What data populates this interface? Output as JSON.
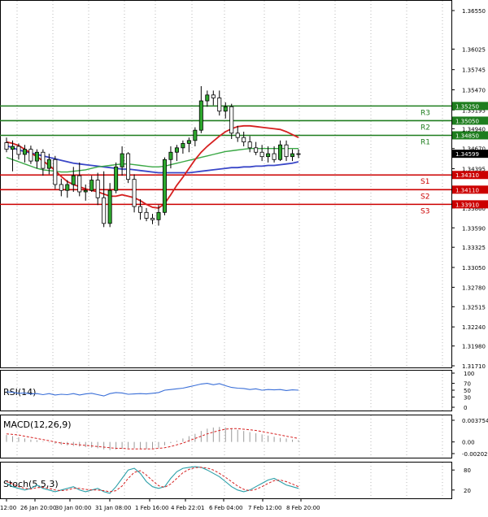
{
  "chart_data": {
    "type": "candlestick",
    "price_axis": {
      "ticks": [
        "1.36550",
        "1.36025",
        "1.35745",
        "1.35470",
        "1.35195",
        "1.34940",
        "1.34670",
        "1.34395",
        "1.34120",
        "1.33860",
        "1.33590",
        "1.33325",
        "1.33050",
        "1.32780",
        "1.32515",
        "1.32240",
        "1.31980",
        "1.31710"
      ],
      "min": 1.3171,
      "max": 1.3655
    },
    "x_axis_labels": [
      "12:00",
      "26 Jan 20:00",
      "30 Jan 00:00",
      "31 Jan 08:00",
      "1 Feb 16:00",
      "4 Feb 22:01",
      "6 Feb 04:00",
      "7 Feb 12:00",
      "8 Feb 20:00"
    ],
    "levels": [
      {
        "name": "R3",
        "value": 1.3525,
        "label": "1.35250",
        "color": "#1e7d1e"
      },
      {
        "name": "R2",
        "value": 1.3505,
        "label": "1.35050",
        "color": "#1e7d1e"
      },
      {
        "name": "R1",
        "value": 1.3485,
        "label": "1.34850",
        "color": "#1e7d1e"
      },
      {
        "name": "S1",
        "value": 1.3431,
        "label": "1.34310",
        "color": "#cc0000"
      },
      {
        "name": "S2",
        "value": 1.3411,
        "label": "1.34110",
        "color": "#cc0000"
      },
      {
        "name": "S3",
        "value": 1.3391,
        "label": "1.33910",
        "color": "#cc0000"
      }
    ],
    "current_price": {
      "value": 1.34599,
      "label": "1.34599"
    },
    "candles": [
      [
        1.3475,
        1.3482,
        1.3462,
        1.3466
      ],
      [
        1.3466,
        1.3478,
        1.3436,
        1.347
      ],
      [
        1.347,
        1.3474,
        1.3452,
        1.3459
      ],
      [
        1.3459,
        1.3472,
        1.3448,
        1.3466
      ],
      [
        1.3466,
        1.3471,
        1.3446,
        1.345
      ],
      [
        1.345,
        1.3466,
        1.344,
        1.3462
      ],
      [
        1.3462,
        1.3466,
        1.343,
        1.344
      ],
      [
        1.344,
        1.346,
        1.3432,
        1.3452
      ],
      [
        1.3452,
        1.3457,
        1.3412,
        1.3418
      ],
      [
        1.3418,
        1.3426,
        1.3402,
        1.341
      ],
      [
        1.341,
        1.3424,
        1.34,
        1.3418
      ],
      [
        1.3418,
        1.3442,
        1.3408,
        1.343
      ],
      [
        1.343,
        1.3448,
        1.3402,
        1.3408
      ],
      [
        1.3408,
        1.3418,
        1.3396,
        1.341
      ],
      [
        1.341,
        1.343,
        1.3408,
        1.3424
      ],
      [
        1.3424,
        1.3434,
        1.339,
        1.34
      ],
      [
        1.34,
        1.3436,
        1.336,
        1.3365
      ],
      [
        1.3365,
        1.342,
        1.336,
        1.341
      ],
      [
        1.341,
        1.3448,
        1.3406,
        1.3442
      ],
      [
        1.3442,
        1.347,
        1.343,
        1.346
      ],
      [
        1.346,
        1.3462,
        1.342,
        1.3425
      ],
      [
        1.3425,
        1.3432,
        1.338,
        1.3388
      ],
      [
        1.3388,
        1.3398,
        1.337,
        1.338
      ],
      [
        1.338,
        1.3386,
        1.3368,
        1.3372
      ],
      [
        1.3372,
        1.3378,
        1.3364,
        1.337
      ],
      [
        1.337,
        1.339,
        1.3362,
        1.338
      ],
      [
        1.338,
        1.3455,
        1.3376,
        1.3452
      ],
      [
        1.3452,
        1.347,
        1.344,
        1.3462
      ],
      [
        1.3462,
        1.3472,
        1.345,
        1.3468
      ],
      [
        1.3468,
        1.3478,
        1.346,
        1.3474
      ],
      [
        1.3474,
        1.3482,
        1.3462,
        1.3478
      ],
      [
        1.3478,
        1.3496,
        1.347,
        1.3492
      ],
      [
        1.3492,
        1.3552,
        1.3488,
        1.3532
      ],
      [
        1.3532,
        1.3546,
        1.3524,
        1.354
      ],
      [
        1.354,
        1.3546,
        1.3526,
        1.3536
      ],
      [
        1.3536,
        1.3546,
        1.3512,
        1.3518
      ],
      [
        1.3518,
        1.353,
        1.3508,
        1.3524
      ],
      [
        1.3524,
        1.3528,
        1.348,
        1.3488
      ],
      [
        1.3488,
        1.3498,
        1.3476,
        1.3482
      ],
      [
        1.3482,
        1.349,
        1.347,
        1.3476
      ],
      [
        1.3476,
        1.3484,
        1.3462,
        1.3468
      ],
      [
        1.3468,
        1.3476,
        1.3458,
        1.3462
      ],
      [
        1.3462,
        1.3472,
        1.345,
        1.3456
      ],
      [
        1.3456,
        1.347,
        1.3448,
        1.346
      ],
      [
        1.346,
        1.347,
        1.3448,
        1.3452
      ],
      [
        1.3452,
        1.3478,
        1.345,
        1.3472
      ],
      [
        1.3472,
        1.3478,
        1.345,
        1.3456
      ],
      [
        1.3456,
        1.3466,
        1.345,
        1.346
      ],
      [
        1.346,
        1.3466,
        1.3454,
        1.3459
      ]
    ],
    "ma_red": [
      1.3476,
      1.3474,
      1.3471,
      1.3466,
      1.3461,
      1.3456,
      1.345,
      1.3444,
      1.3437,
      1.3429,
      1.3422,
      1.3418,
      1.3415,
      1.3412,
      1.341,
      1.3408,
      1.3405,
      1.3402,
      1.3402,
      1.3404,
      1.3402,
      1.34,
      1.3396,
      1.3391,
      1.3387,
      1.3386,
      1.3392,
      1.3404,
      1.3417,
      1.3428,
      1.344,
      1.3452,
      1.3462,
      1.347,
      1.3477,
      1.3484,
      1.349,
      1.3494,
      1.3497,
      1.3498,
      1.3498,
      1.3497,
      1.3496,
      1.3495,
      1.3494,
      1.3493,
      1.349,
      1.3486,
      1.3482
    ],
    "ma_green": [
      1.3455,
      1.3452,
      1.3449,
      1.3446,
      1.3443,
      1.344,
      1.3438,
      1.3437,
      1.3436,
      1.3435,
      1.3435,
      1.3436,
      1.3437,
      1.3438,
      1.344,
      1.3442,
      1.3443,
      1.3444,
      1.3445,
      1.3446,
      1.3446,
      1.3445,
      1.3444,
      1.3443,
      1.3442,
      1.3442,
      1.3443,
      1.3445,
      1.3447,
      1.3449,
      1.3451,
      1.3453,
      1.3455,
      1.3457,
      1.3459,
      1.3461,
      1.3463,
      1.3464,
      1.3465,
      1.3466,
      1.3467,
      1.3467,
      1.3467,
      1.3467,
      1.3467,
      1.3467,
      1.3467,
      1.3467,
      1.3467
    ],
    "ma_blue": [
      1.3471,
      1.3468,
      1.3465,
      1.3463,
      1.3461,
      1.3459,
      1.3457,
      1.3455,
      1.3453,
      1.3451,
      1.3449,
      1.3447,
      1.3446,
      1.3445,
      1.3444,
      1.3443,
      1.3442,
      1.3441,
      1.344,
      1.3439,
      1.3439,
      1.3438,
      1.3437,
      1.3436,
      1.3435,
      1.3434,
      1.3434,
      1.3434,
      1.3434,
      1.3434,
      1.3434,
      1.3435,
      1.3436,
      1.3437,
      1.3438,
      1.3439,
      1.344,
      1.3441,
      1.3441,
      1.3442,
      1.3442,
      1.3443,
      1.3443,
      1.3444,
      1.3444,
      1.3445,
      1.3446,
      1.3447,
      1.3449
    ],
    "rsi": {
      "label": "RSI(14)",
      "ticks": [
        "100",
        "70",
        "50",
        "30",
        "0"
      ],
      "values": [
        45,
        44,
        41,
        42,
        39,
        40,
        37,
        40,
        36,
        38,
        37,
        40,
        36,
        39,
        41,
        37,
        33,
        40,
        43,
        42,
        38,
        39,
        40,
        39,
        41,
        43,
        50,
        52,
        54,
        56,
        60,
        64,
        68,
        70,
        66,
        69,
        63,
        58,
        56,
        55,
        52,
        54,
        50,
        52,
        51,
        52,
        49,
        51,
        50
      ]
    },
    "macd": {
      "label": "MACD(12,26,9)",
      "ticks": [
        "0.003754",
        "0.00",
        "-0.002021"
      ],
      "histogram": [
        0.0012,
        0.001,
        0.0008,
        0.0006,
        0.0004,
        0.0003,
        0.0001,
        -0.0001,
        -0.0003,
        -0.0005,
        -0.0006,
        -0.0007,
        -0.0008,
        -0.0009,
        -0.001,
        -0.0011,
        -0.0013,
        -0.0014,
        -0.0013,
        -0.0012,
        -0.0011,
        -0.0011,
        -0.0012,
        -0.0012,
        -0.0011,
        -0.001,
        -0.0006,
        -0.0002,
        0.0002,
        0.0006,
        0.001,
        0.0014,
        0.0019,
        0.0023,
        0.0025,
        0.0026,
        0.0025,
        0.0023,
        0.0021,
        0.0019,
        0.0017,
        0.0015,
        0.0013,
        0.0011,
        0.0009,
        0.0007,
        0.0006,
        0.0004,
        0.0003
      ],
      "signal": [
        0.0014,
        0.0013,
        0.0012,
        0.001,
        0.0008,
        0.0006,
        0.0004,
        0.0002,
        0.0,
        -0.0002,
        -0.0003,
        -0.0004,
        -0.0005,
        -0.0006,
        -0.0007,
        -0.0008,
        -0.0009,
        -0.001,
        -0.0011,
        -0.0011,
        -0.0012,
        -0.0012,
        -0.0012,
        -0.0012,
        -0.0012,
        -0.0011,
        -0.001,
        -0.0008,
        -0.0005,
        -0.0002,
        0.0002,
        0.0006,
        0.001,
        0.0014,
        0.0017,
        0.002,
        0.0022,
        0.0023,
        0.0023,
        0.0022,
        0.0021,
        0.002,
        0.0018,
        0.0016,
        0.0014,
        0.0012,
        0.001,
        0.0008,
        0.0006
      ]
    },
    "stoch": {
      "label": "Stoch(5,5,3)",
      "ticks": [
        "80",
        "20"
      ],
      "k": [
        40,
        30,
        25,
        20,
        25,
        35,
        25,
        20,
        15,
        20,
        25,
        30,
        20,
        15,
        20,
        25,
        15,
        10,
        30,
        55,
        80,
        85,
        70,
        45,
        30,
        25,
        30,
        55,
        75,
        85,
        88,
        90,
        88,
        80,
        70,
        60,
        45,
        30,
        20,
        15,
        20,
        30,
        40,
        50,
        55,
        45,
        35,
        30,
        25
      ],
      "d": [
        45,
        38,
        30,
        25,
        23,
        27,
        28,
        25,
        20,
        18,
        20,
        25,
        25,
        22,
        20,
        20,
        18,
        15,
        18,
        32,
        55,
        73,
        78,
        65,
        48,
        33,
        28,
        38,
        55,
        72,
        82,
        87,
        88,
        86,
        80,
        70,
        58,
        45,
        32,
        22,
        18,
        22,
        30,
        40,
        48,
        50,
        45,
        38,
        30
      ]
    }
  }
}
